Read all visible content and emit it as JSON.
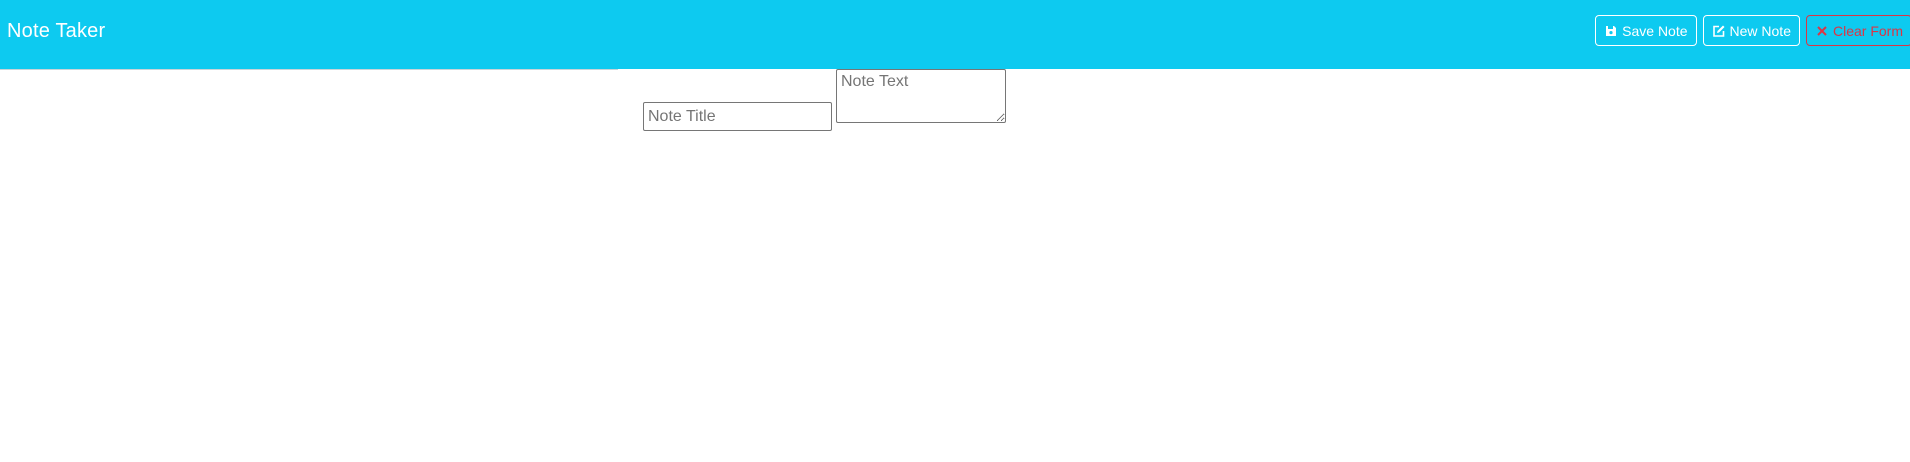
{
  "app": {
    "title": "Note Taker"
  },
  "toolbar": {
    "save_label": "Save Note",
    "new_label": "New Note",
    "clear_label": "Clear Form"
  },
  "form": {
    "title_placeholder": "Note Title",
    "title_value": "",
    "text_placeholder": "Note Text",
    "text_value": ""
  },
  "colors": {
    "navbar_bg": "#0dcaf0",
    "button_border": "#ffffff",
    "danger": "#dc3545"
  },
  "icons": {
    "save": "floppy-disk-icon",
    "new": "edit-pen-icon",
    "clear": "x-mark-icon"
  }
}
